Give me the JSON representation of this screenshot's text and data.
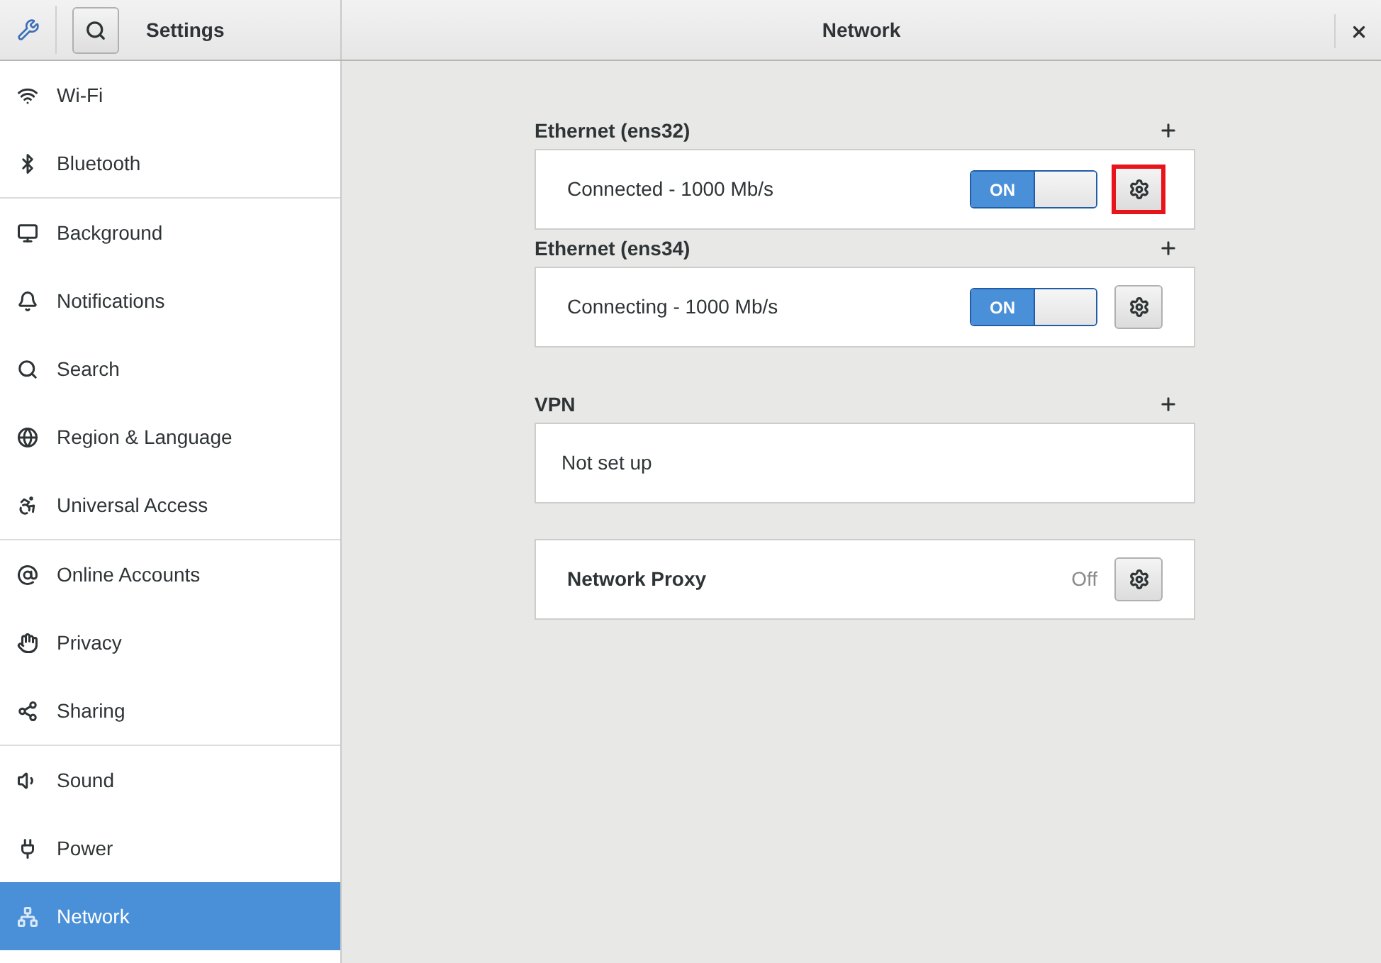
{
  "header": {
    "app_title": "Settings",
    "page_title": "Network"
  },
  "sidebar": {
    "groups": [
      {
        "items": [
          {
            "label": "Wi-Fi",
            "selected": false
          },
          {
            "label": "Bluetooth",
            "selected": false
          }
        ]
      },
      {
        "items": [
          {
            "label": "Background",
            "selected": false
          },
          {
            "label": "Notifications",
            "selected": false
          },
          {
            "label": "Search",
            "selected": false
          },
          {
            "label": "Region & Language",
            "selected": false
          },
          {
            "label": "Universal Access",
            "selected": false
          }
        ]
      },
      {
        "items": [
          {
            "label": "Online Accounts",
            "selected": false
          },
          {
            "label": "Privacy",
            "selected": false
          },
          {
            "label": "Sharing",
            "selected": false
          }
        ]
      },
      {
        "items": [
          {
            "label": "Sound",
            "selected": false
          },
          {
            "label": "Power",
            "selected": false
          },
          {
            "label": "Network",
            "selected": true
          }
        ]
      }
    ]
  },
  "sections": [
    {
      "kind": "device",
      "title": "Ethernet (ens32)",
      "status": "Connected - 1000 Mb/s",
      "switch_label": "ON",
      "on": true,
      "highlighted": true
    },
    {
      "kind": "device",
      "title": "Ethernet (ens34)",
      "status": "Connecting - 1000 Mb/s",
      "switch_label": "ON",
      "on": true,
      "highlighted": false
    },
    {
      "kind": "vpn",
      "title": "VPN",
      "status": "Not set up"
    },
    {
      "kind": "proxy",
      "label": "Network Proxy",
      "value": "Off"
    }
  ]
}
